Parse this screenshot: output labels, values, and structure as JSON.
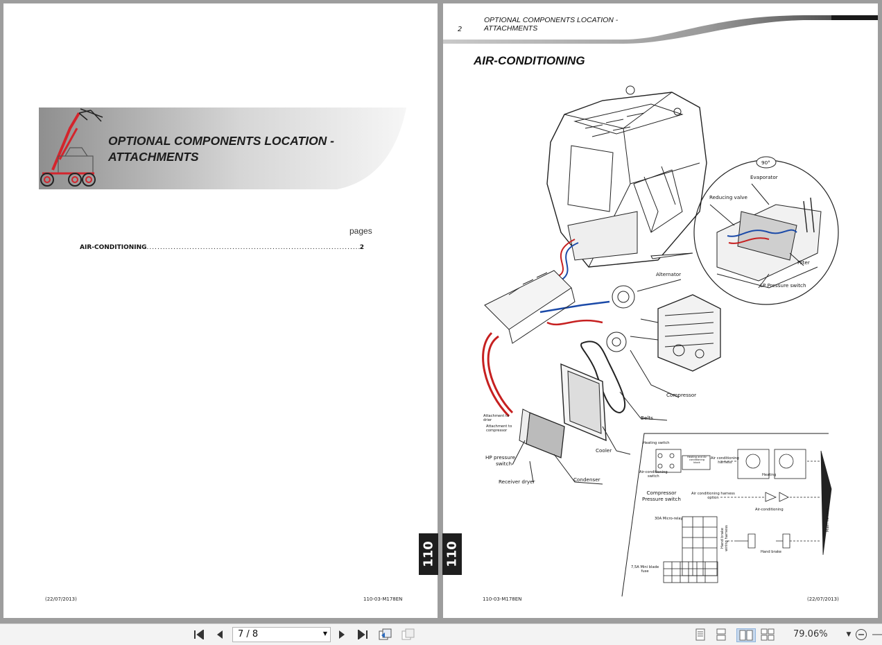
{
  "left_page": {
    "banner_title_line1": "OPTIONAL COMPONENTS LOCATION -",
    "banner_title_line2": "ATTACHMENTS",
    "pages_label": "pages",
    "toc": [
      {
        "title": "AIR-CONDITIONING",
        "page": "2"
      }
    ],
    "footer_date": "(22/07/2013)",
    "footer_code": "110-03-M178EN",
    "tab_number": "110"
  },
  "right_page": {
    "header_number": "2",
    "header_title_line1": "OPTIONAL COMPONENTS LOCATION -",
    "header_title_line2": "ATTACHMENTS",
    "section_title": "AIR-CONDITIONING",
    "tab_number": "110",
    "footer_code": "110-03-M178EN",
    "footer_date": "(22/07/2013)",
    "labels": {
      "angle": "90°",
      "evaporator": "Evaporator",
      "reducing_valve": "Reducing valve",
      "filter": "Filter",
      "lp_pressure_switch": "LP Pressure switch",
      "alternator": "Alternator",
      "compressor": "Compressor",
      "belts": "Belts",
      "cooler": "Cooler",
      "condenser": "Condenser",
      "receiver_dryer": "Receiver dryer",
      "hp_pressure_line1": "HP pressure",
      "hp_pressure_line2": "switch",
      "attach_drier_line1": "Attachment to",
      "attach_drier_line2": "drier",
      "attach_comp_line1": "Attachment to",
      "attach_comp_line2": "compressor",
      "heating_switch": "Heating switch",
      "ac_switch_line1": "Air-conditioning",
      "ac_switch_line2": "switch",
      "heating_block_line1": "Heating and Air",
      "heating_block_line2": "conditioning",
      "heating_block_line3": "block",
      "ac_harness_line1": "Air conditioning",
      "ac_harness_line2": "harness",
      "heating": "Heating",
      "compressor_ps_line1": "Compressor",
      "compressor_ps_line2": "Pressure switch",
      "ac_harness_option_line1": "Air conditioning harness",
      "ac_harness_option_line2": "option",
      "air_conditioning": "Air-conditioning",
      "micro_relay": "30A Micro-relay",
      "hand_brake_wiring_line1": "Hand brake",
      "hand_brake_wiring_line2": "wiring harness",
      "hand_brake": "Hand brake",
      "main_harness": "Main harness",
      "mini_blade_line1": "7,5A Mini blade",
      "mini_blade_line2": "fuse"
    }
  },
  "toolbar": {
    "page_indicator": "7 / 8",
    "zoom": "79.06%"
  },
  "colors": {
    "banner_red": "#d4242c",
    "dark_tab": "#1e1e1e"
  }
}
